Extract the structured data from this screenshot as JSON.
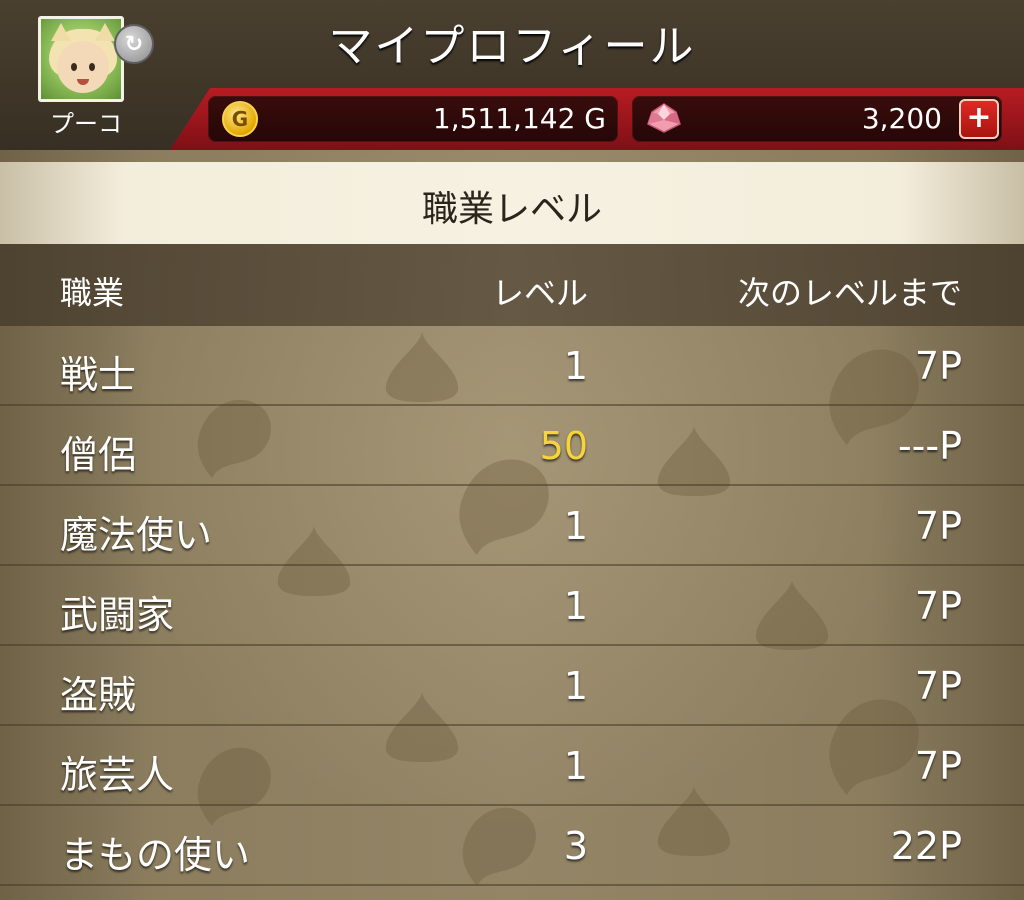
{
  "header": {
    "title": "マイプロフィール",
    "player_name": "プーコ",
    "avatar_icon": "character-portrait",
    "swap_icon": "refresh-icon"
  },
  "currency": {
    "gold": {
      "icon": "gold-coin-icon",
      "amount": "1,511,142 G"
    },
    "gems": {
      "icon": "gem-icon",
      "amount": "3,200",
      "add_label": "+"
    }
  },
  "section": {
    "title": "職業レベル"
  },
  "table": {
    "columns": [
      "職業",
      "レベル",
      "次のレベルまで"
    ],
    "rows": [
      {
        "job": "戦士",
        "level": "1",
        "next": "7P"
      },
      {
        "job": "僧侶",
        "level": "50",
        "next": "---P",
        "max_level": true
      },
      {
        "job": "魔法使い",
        "level": "1",
        "next": "7P"
      },
      {
        "job": "武闘家",
        "level": "1",
        "next": "7P"
      },
      {
        "job": "盗賊",
        "level": "1",
        "next": "7P"
      },
      {
        "job": "旅芸人",
        "level": "1",
        "next": "7P"
      },
      {
        "job": "まもの使い",
        "level": "3",
        "next": "22P"
      }
    ]
  },
  "colors": {
    "header_bg": "#3f3628",
    "currency_bar": "#b71c22",
    "parchment": "#948567",
    "max_level": "#f6d43a"
  }
}
